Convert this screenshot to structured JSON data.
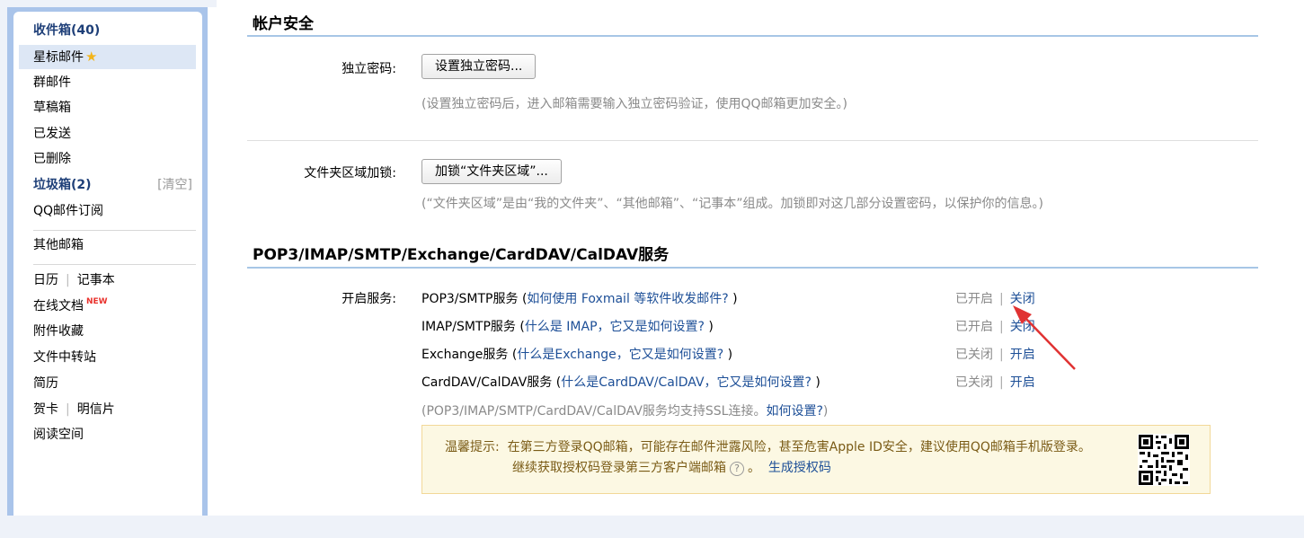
{
  "sidebar": {
    "items": [
      {
        "label": "收件箱(40)",
        "bold": true
      },
      {
        "label": "星标邮件",
        "star": true
      },
      {
        "label": "群邮件"
      },
      {
        "label": "草稿箱"
      },
      {
        "label": "已发送"
      },
      {
        "label": "已删除"
      },
      {
        "label": "垃圾箱(2)",
        "bold": true,
        "extra": "[清空]"
      },
      {
        "label": "QQ邮件订阅"
      },
      {
        "label": "其他邮箱"
      },
      {
        "label": "日历",
        "second": "记事本"
      },
      {
        "label": "在线文档",
        "badge": "NEW"
      },
      {
        "label": "附件收藏"
      },
      {
        "label": "文件中转站"
      },
      {
        "label": "简历"
      },
      {
        "label": "贺卡",
        "second": "明信片"
      },
      {
        "label": "阅读空间"
      }
    ]
  },
  "account_security": {
    "title": "帐户安全",
    "password_label": "独立密码:",
    "password_button": "设置独立密码...",
    "password_hint": "(设置独立密码后，进入邮箱需要输入独立密码验证，使用QQ邮箱更加安全。)",
    "folder_label": "文件夹区域加锁:",
    "folder_button": "加锁“文件夹区域”...",
    "folder_hint": "(“文件夹区域”是由“我的文件夹”、“其他邮箱”、“记事本”组成。加锁即对这几部分设置密码，以保护你的信息。)"
  },
  "services": {
    "title": "POP3/IMAP/SMTP/Exchange/CardDAV/CalDAV服务",
    "label": "开启服务:",
    "rows": [
      {
        "name": "POP3/SMTP服务",
        "link": "如何使用 Foxmail 等软件收发邮件?",
        "status": "已开启",
        "action": "关闭"
      },
      {
        "name": "IMAP/SMTP服务",
        "link": "什么是 IMAP，它又是如何设置?",
        "status": "已开启",
        "action": "关闭"
      },
      {
        "name": "Exchange服务",
        "link": "什么是Exchange，它又是如何设置?",
        "status": "已关闭",
        "action": "开启"
      },
      {
        "name": "CardDAV/CalDAV服务",
        "link": "什么是CardDAV/CalDAV，它又是如何设置?",
        "status": "已关闭",
        "action": "开启"
      }
    ],
    "ssl_hint": "(POP3/IMAP/SMTP/CardDAV/CalDAV服务均支持SSL连接。",
    "ssl_link": "如何设置?",
    "ssl_hint_end": ")"
  },
  "tip": {
    "prefix": "温馨提示:",
    "line1": "在第三方登录QQ邮箱，可能存在邮件泄露风险，甚至危害Apple ID安全，建议使用QQ邮箱手机版登录。",
    "line2": "继续获取授权码登录第三方客户端邮箱",
    "line2_end": "。",
    "help_icon": "?",
    "generate_link": "生成授权码"
  },
  "colors": {
    "accent_link": "#1d4f97",
    "sidebar_frame": "#a9c4ea",
    "tip_bg": "#fcf8e3",
    "arrow": "#e03232"
  }
}
